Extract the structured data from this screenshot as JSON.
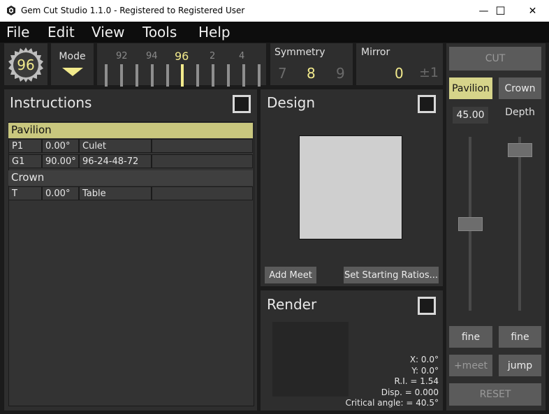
{
  "window": {
    "title": "Gem Cut Studio 1.1.0 - Registered to Registered User",
    "minimize": "—",
    "maximize": "☐",
    "close": "✕"
  },
  "menu": [
    "File",
    "Edit",
    "View",
    "Tools",
    "Help"
  ],
  "toolbar": {
    "index": "96",
    "mode_label": "Mode",
    "dial": {
      "labels": [
        "92",
        "94",
        "96",
        "2",
        "4"
      ],
      "selected": "96"
    },
    "symmetry": {
      "title": "Symmetry",
      "prev": "7",
      "current": "8",
      "next": "9"
    },
    "mirror": {
      "title": "Mirror",
      "value": "0",
      "alt": "±1"
    }
  },
  "instructions": {
    "title": "Instructions",
    "groups": [
      {
        "name": "Pavilion",
        "rows": [
          [
            "P1",
            "0.00°",
            "Culet",
            ""
          ],
          [
            "G1",
            "90.00°",
            "96-24-48-72",
            ""
          ]
        ]
      },
      {
        "name": "Crown",
        "rows": [
          [
            "T",
            "0.00°",
            "Table",
            ""
          ]
        ]
      }
    ]
  },
  "design": {
    "title": "Design",
    "add_meet": "Add Meet",
    "starting_ratios": "Set Starting Ratios..."
  },
  "render": {
    "title": "Render",
    "x": "X: 0.0°",
    "y": "Y: 0.0°",
    "ri": "R.I. = 1.54",
    "disp": "Disp. = 0.000",
    "critical": "Critical angle: = 40.5°"
  },
  "right": {
    "cut": "CUT",
    "pavilion": "Pavilion",
    "crown": "Crown",
    "angle": "45.00",
    "depth": "Depth",
    "angle_slider": 0.5,
    "depth_slider": 1.0,
    "fine_left": "fine",
    "fine_right": "fine",
    "meet": "+meet",
    "jump": "jump",
    "reset": "RESET"
  },
  "colors": {
    "accent": "#d6d48a",
    "highlight_text": "#f2ea8c"
  }
}
